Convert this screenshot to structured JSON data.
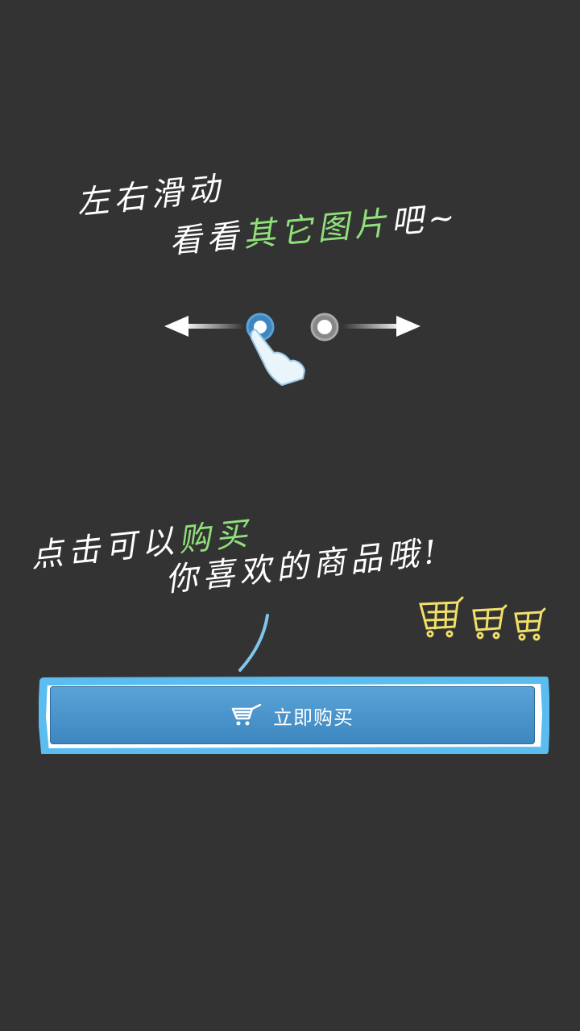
{
  "hint_swipe": {
    "line1": "左右滑动",
    "line2_prefix": "看看",
    "line2_highlight": "其它图片",
    "line2_suffix": "吧~"
  },
  "hint_buy": {
    "line1_prefix": "点击可以",
    "line1_highlight": "购买",
    "line2": "你喜欢的商品哦!"
  },
  "buy_button": {
    "label": "立即购买",
    "icon": "shopping-cart-icon"
  },
  "colors": {
    "background": "#333333",
    "highlight": "#8fe07a",
    "button": "#4a90c8",
    "frame": "#5bbcf0",
    "cart_doodle": "#f0e06a"
  }
}
